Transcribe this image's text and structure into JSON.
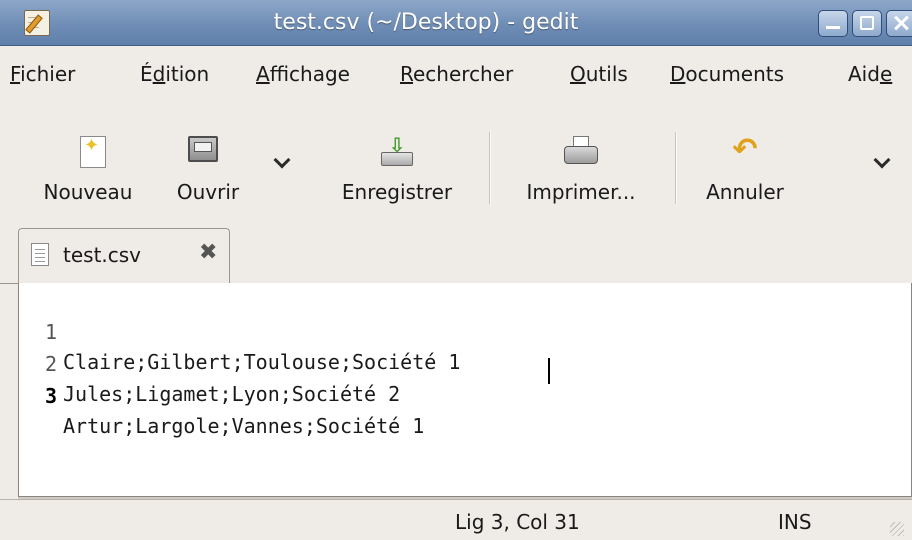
{
  "window": {
    "title": "test.csv (~/Desktop) - gedit",
    "app_icon": "gedit-pencil-icon",
    "controls": [
      "minimize",
      "maximize",
      "close"
    ]
  },
  "menubar": {
    "items": [
      {
        "label": "Fichier",
        "mnemonic": "F",
        "rest": "ichier"
      },
      {
        "label": "Édition",
        "pre": "É",
        "mnemonic": "d",
        "rest": "ition"
      },
      {
        "label": "Affichage",
        "mnemonic": "A",
        "rest": "ffichage"
      },
      {
        "label": "Rechercher",
        "mnemonic": "R",
        "rest": "echercher"
      },
      {
        "label": "Outils",
        "mnemonic": "O",
        "rest": "utils"
      },
      {
        "label": "Documents",
        "mnemonic": "D",
        "rest": "ocuments"
      },
      {
        "label": "Aide",
        "pre": "Aid",
        "mnemonic": "e",
        "rest": ""
      }
    ]
  },
  "toolbar": {
    "new_label": "Nouveau",
    "open_label": "Ouvrir",
    "save_label": "Enregistrer",
    "print_label": "Imprimer...",
    "undo_label": "Annuler"
  },
  "tabs": [
    {
      "label": "test.csv",
      "active": true
    }
  ],
  "editor": {
    "lines": [
      {
        "number": "1",
        "text": "Claire;Gilbert;Toulouse;Société 1"
      },
      {
        "number": "2",
        "text": "Jules;Ligamet;Lyon;Société 2"
      },
      {
        "number": "3",
        "text": "Artur;Largole;Vannes;Société 1"
      }
    ],
    "current_line": 3
  },
  "statusbar": {
    "position": "Lig 3, Col 31",
    "mode": "INS"
  }
}
